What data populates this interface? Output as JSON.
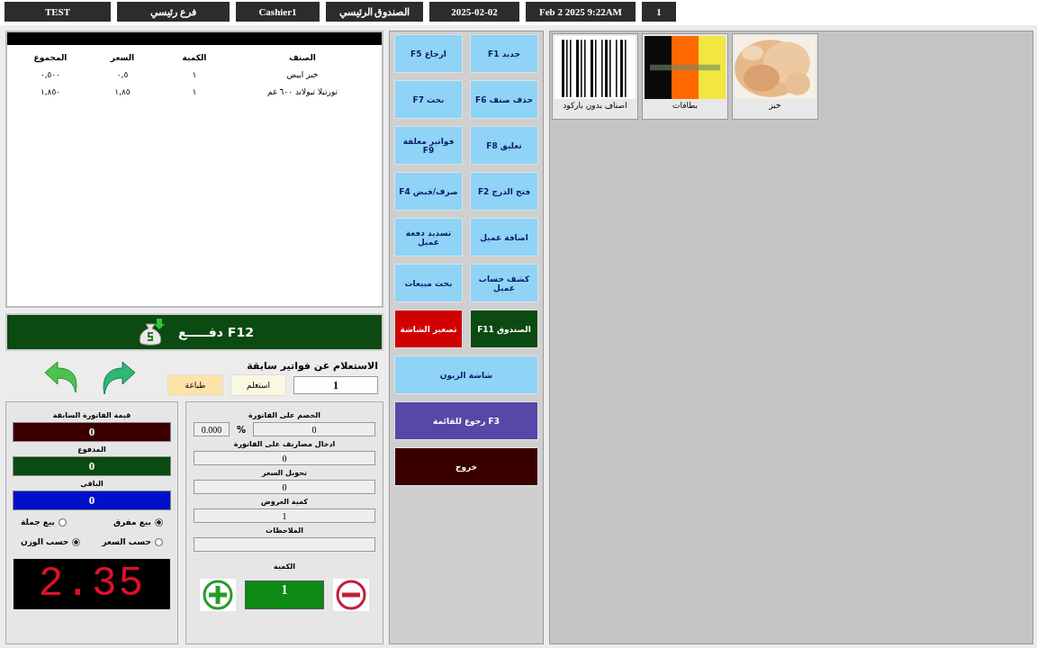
{
  "top_bar": [
    "1",
    "Feb  2 2025  9:22AM",
    "2025-02-02",
    "الصندوق الرئيسي",
    "Cashier1",
    "فرع رئيسي",
    "TEST"
  ],
  "invoice": {
    "columns": [
      "الصنف",
      "الكمية",
      "السعر",
      "المجموع"
    ],
    "rows": [
      [
        "خبز ابيض",
        "١",
        "٠,٥",
        "٠,٥٠٠"
      ],
      [
        "تورتيلا تيولاند ٦٠٠ غم",
        "١",
        "١,٨٥",
        "١,٨٥٠"
      ]
    ]
  },
  "pay_button": "دفـــــع F12",
  "inquiry": {
    "label": "الاستعلام عن فواتير سابقة",
    "value": "1",
    "buttons": [
      "استعلم",
      "طباعة"
    ]
  },
  "totals": [
    {
      "label": "قيمة الفاتورة السابقة",
      "value": "0",
      "color": "#3a0000"
    },
    {
      "label": "المدفوع",
      "value": "0",
      "color": "#0b4a10"
    },
    {
      "label": "الباقي",
      "value": "0",
      "color": "#0010c8"
    }
  ],
  "radio_groups": [
    [
      {
        "label": "بيع مفرق",
        "selected": true
      },
      {
        "label": "بيع جملة",
        "selected": false
      }
    ],
    [
      {
        "label": "حسب السعر",
        "selected": false
      },
      {
        "label": "حسب الوزن",
        "selected": true
      }
    ]
  ],
  "scale_display": "2.35",
  "discount": {
    "label": "الخصم على الفاتورة",
    "amount": "0",
    "percent_sign": "%",
    "percent": "0.000"
  },
  "fields": [
    {
      "label": "ادخال مصاريف على الفاتورة",
      "value": "0"
    },
    {
      "label": "تحويل السعر",
      "value": "0"
    },
    {
      "label": "كمية العروض",
      "value": "1"
    },
    {
      "label": "الملاحظات"
    }
  ],
  "quantity": {
    "label": "الكمية",
    "value": "1"
  },
  "function_keys": [
    "جديد F1",
    "ارجاع F5",
    "حذف صنف F6",
    "بحث F7",
    "تعليق F8",
    "فواتير معلقة F9",
    "فتح الدرج F2",
    "صرف/قبض F4",
    "اضافة عميل",
    "تسديد دفعة عميل",
    "كشف حساب عميل",
    "بحث مبيعات"
  ],
  "action_buttons": [
    {
      "label": "الصندوق F11",
      "color": "#0b4a10",
      "kind": "half"
    },
    {
      "label": "تصغير الشاشة",
      "color": "#d00000",
      "kind": "half"
    },
    {
      "label": "شاشة الزبون",
      "color": "#8fd3f7",
      "kind": "wide"
    },
    {
      "label": "F3 رجوع للقائمة",
      "color": "#5548a8",
      "kind": "wide"
    },
    {
      "label": "خروج",
      "color": "#3a0000",
      "kind": "wide"
    }
  ],
  "products": [
    {
      "label": "خبز",
      "kind": "picture"
    },
    {
      "label": "بطاقات",
      "kind": "picture"
    },
    {
      "label": "اصناف بدون باركود",
      "kind": "picture"
    }
  ]
}
